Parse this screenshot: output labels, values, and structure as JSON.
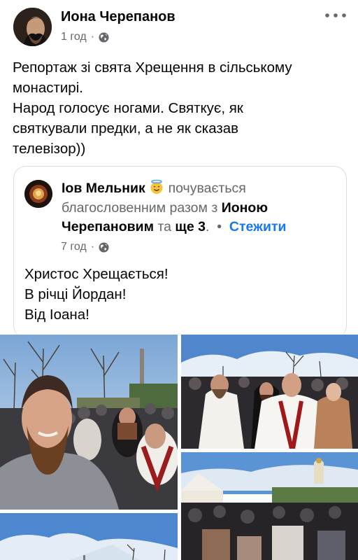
{
  "post": {
    "author": "Иона Черепанов",
    "time": "1 год",
    "dot": "·",
    "text_lines": [
      "Репортаж зі свята Хрещення в сільському",
      "монастирі.",
      "Народ голосує ногами. Святкує, як",
      "святкували предки, а не як сказав",
      "телевізор))"
    ]
  },
  "shared": {
    "author": "Іов Мельник",
    "feeling": "почувається",
    "feeling_rest": "благословенним разом з",
    "with_name": "Ионою Черепановим",
    "and_more": "та",
    "others": "ще 3",
    "period": ".",
    "sep": "•",
    "follow": "Стежити",
    "time": "7 год",
    "dot": "·",
    "text_lines": [
      "Христос Хрещається!",
      "В річці Йордан!",
      "Від Іоана!"
    ]
  },
  "icons": {
    "globe": "globe-icon",
    "more": "more-dots-icon",
    "feeling": "halo-smiley-emoji"
  }
}
